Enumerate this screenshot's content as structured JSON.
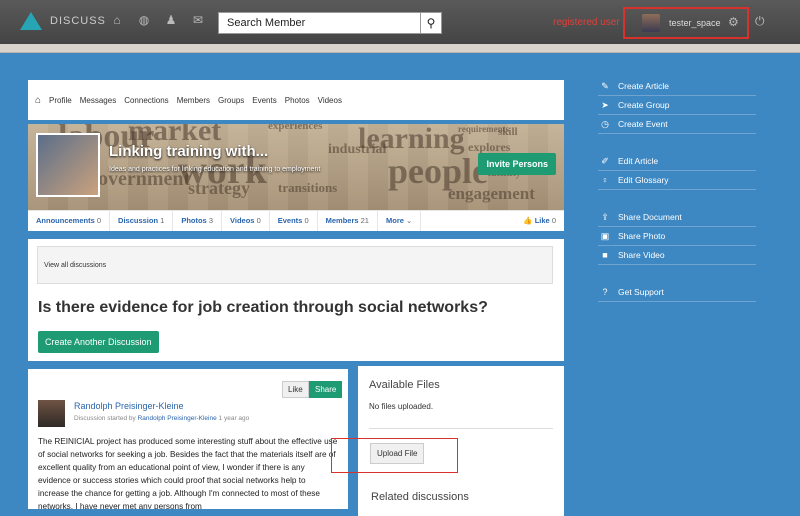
{
  "app": {
    "brand": "DISCUSS"
  },
  "search": {
    "placeholder": "Search Member"
  },
  "user": {
    "role": "registered user",
    "username": "tester_space"
  },
  "group_nav": [
    "Profile",
    "Messages",
    "Connections",
    "Members",
    "Groups",
    "Events",
    "Photos",
    "Videos"
  ],
  "banner": {
    "words": [
      "labour",
      "market",
      "experiences",
      "learning",
      "work",
      "people",
      "government",
      "strategy",
      "transitions",
      "engagement",
      "skill",
      "industrial",
      "requirements",
      "explores",
      "identity"
    ]
  },
  "group": {
    "title": "Linking training with...",
    "description": "Ideas and practices for linking education and training to employment",
    "invite_label": "Invite Persons"
  },
  "tabs": [
    {
      "label": "Announcements",
      "count": "0"
    },
    {
      "label": "Discussion",
      "count": "1"
    },
    {
      "label": "Photos",
      "count": "3"
    },
    {
      "label": "Videos",
      "count": "0"
    },
    {
      "label": "Events",
      "count": "0"
    },
    {
      "label": "Members",
      "count": "21"
    },
    {
      "label": "More",
      "count": "⌄"
    }
  ],
  "like_tab": {
    "label": "Like",
    "count": "0"
  },
  "discussion": {
    "view_all": "View all discussions",
    "title": "Is there evidence for job creation through social networks?",
    "create_label": "Create Another Discussion"
  },
  "post": {
    "like_label": "Like",
    "share_label": "Share",
    "author": "Randolph Preisinger-Kleine",
    "meta_prefix": "Discussion started by",
    "meta_author": "Randolph Preisinger-Kleine",
    "meta_time": "1 year ago",
    "body": "The REINICIAL project has produced some interesting stuff about the effective use of social networks for seeking a job. Besides the fact that the materials itself are of excellent quality from an educational point of view, I wonder if there is any evidence or success stories which could proof that social networks help to increase the chance for getting a job. Although I'm connected to most of these networks, I have never met any persons from"
  },
  "files": {
    "title": "Available Files",
    "empty": "No files uploaded.",
    "upload_label": "Upload File",
    "related_title": "Related discussions"
  },
  "sidebar": [
    {
      "label": "Create Article",
      "icon": "pencil-icon",
      "glyph": "✎"
    },
    {
      "label": "Create Group",
      "icon": "send-icon",
      "glyph": "➤"
    },
    {
      "label": "Create Event",
      "icon": "clock-icon",
      "glyph": "◷"
    },
    {
      "label": "",
      "icon": "",
      "glyph": ""
    },
    {
      "label": "Edit Article",
      "icon": "edit-icon",
      "glyph": "✐"
    },
    {
      "label": "Edit Glossary",
      "icon": "lightbulb-icon",
      "glyph": "♀"
    },
    {
      "label": "",
      "icon": "",
      "glyph": ""
    },
    {
      "label": "Share Document",
      "icon": "upload-icon",
      "glyph": "⇪"
    },
    {
      "label": "Share Photo",
      "icon": "photo-icon",
      "glyph": "▣"
    },
    {
      "label": "Share Video",
      "icon": "video-icon",
      "glyph": "■"
    },
    {
      "label": "",
      "icon": "",
      "glyph": ""
    },
    {
      "label": "Get Support",
      "icon": "question-icon",
      "glyph": "?"
    }
  ]
}
